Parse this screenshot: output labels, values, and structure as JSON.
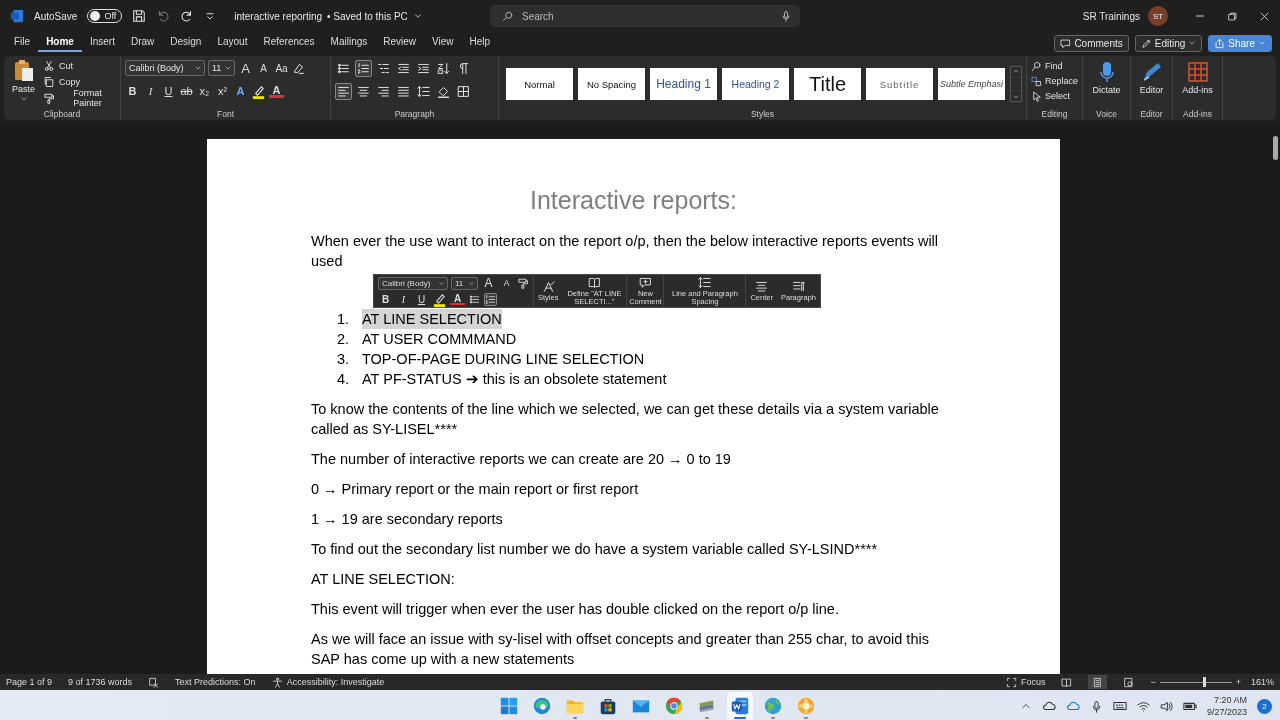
{
  "title_bar": {
    "autosave": {
      "label": "AutoSave",
      "on": false,
      "state": "Off"
    },
    "document_name": "interactive reporting",
    "save_status": "• Saved to this PC",
    "search": {
      "placeholder": "Search"
    },
    "user": {
      "name": "SR Trainings",
      "initials": "ST"
    }
  },
  "menu_tabs": [
    {
      "label": "File",
      "selected": false
    },
    {
      "label": "Home",
      "selected": true
    },
    {
      "label": "Insert",
      "selected": false
    },
    {
      "label": "Draw",
      "selected": false
    },
    {
      "label": "Design",
      "selected": false
    },
    {
      "label": "Layout",
      "selected": false
    },
    {
      "label": "References",
      "selected": false
    },
    {
      "label": "Mailings",
      "selected": false
    },
    {
      "label": "Review",
      "selected": false
    },
    {
      "label": "View",
      "selected": false
    },
    {
      "label": "Help",
      "selected": false
    }
  ],
  "header_buttons": [
    {
      "kind": "comments",
      "label": "Comments"
    },
    {
      "kind": "editing",
      "label": "Editing"
    },
    {
      "kind": "share",
      "label": "Share"
    }
  ],
  "ribbon": {
    "clipboard": {
      "label": "Clipboard",
      "paste": "Paste",
      "tools": [
        {
          "kind": "cut",
          "label": "Cut"
        },
        {
          "kind": "copy",
          "label": "Copy"
        },
        {
          "kind": "format_painter",
          "label": "Format Painter"
        }
      ]
    },
    "font": {
      "label": "Font",
      "font_name": "Calibri (Body)",
      "font_size": "11",
      "size_tools": [
        {
          "kind": "grow",
          "glyph": "A"
        },
        {
          "kind": "shrink",
          "glyph": "A"
        },
        {
          "kind": "case",
          "glyph": "Aa"
        }
      ],
      "format_tools": [
        {
          "kind": "bold",
          "glyph": "B"
        },
        {
          "kind": "italic",
          "glyph": "I"
        },
        {
          "kind": "underline",
          "glyph": "U"
        },
        {
          "kind": "strike",
          "glyph": "ab"
        },
        {
          "kind": "subscript",
          "glyph": "x₂"
        },
        {
          "kind": "superscript",
          "glyph": "x²"
        },
        {
          "kind": "effects",
          "glyph": "A"
        },
        {
          "kind": "highlight"
        },
        {
          "kind": "font_color",
          "glyph": "A"
        }
      ]
    },
    "paragraph": {
      "label": "Paragraph",
      "row1": [
        {
          "kind": "bullets",
          "on": false
        },
        {
          "kind": "numbering",
          "on": true
        },
        {
          "kind": "multilevel",
          "on": false
        },
        {
          "kind": "decrease_indent",
          "on": false
        },
        {
          "kind": "increase_indent",
          "on": false
        },
        {
          "kind": "sort",
          "on": false
        },
        {
          "kind": "show_marks",
          "on": false
        }
      ],
      "row2": [
        {
          "kind": "align_left",
          "on": true
        },
        {
          "kind": "align_center",
          "on": false
        },
        {
          "kind": "align_right",
          "on": false
        },
        {
          "kind": "justify",
          "on": false
        },
        {
          "kind": "line_spacing",
          "on": false
        },
        {
          "kind": "shading",
          "on": false
        },
        {
          "kind": "borders",
          "on": false
        }
      ]
    },
    "styles": {
      "label": "Styles",
      "items": [
        {
          "kind": "normal",
          "label": "Normal"
        },
        {
          "kind": "no_spacing",
          "label": "No Spacing"
        },
        {
          "kind": "heading1",
          "label": "Heading 1"
        },
        {
          "kind": "heading2",
          "label": "Heading 2"
        },
        {
          "kind": "title",
          "label": "Title"
        },
        {
          "kind": "subtitle",
          "label": "Subtitle"
        },
        {
          "kind": "subtle_emphasis",
          "label": "Subtle Emphasi"
        }
      ]
    },
    "editing": {
      "label": "Editing",
      "items": [
        {
          "kind": "find",
          "label": "Find"
        },
        {
          "kind": "replace",
          "label": "Replace"
        },
        {
          "kind": "select",
          "label": "Select"
        }
      ]
    },
    "voice": {
      "label": "Voice",
      "button": "Dictate"
    },
    "editor": {
      "label": "Editor",
      "button": "Editor"
    },
    "addins": {
      "label": "Add-ins",
      "button": "Add-ins"
    }
  },
  "mini_toolbar": {
    "font_name": "Calibri (Body)",
    "font_size": "11",
    "size_tools": [
      {
        "kind": "grow",
        "glyph": "A"
      },
      {
        "kind": "shrink",
        "glyph": "A"
      }
    ],
    "format_tools": [
      {
        "kind": "bold",
        "glyph": "B"
      },
      {
        "kind": "italic",
        "glyph": "I"
      },
      {
        "kind": "underline",
        "glyph": "U"
      },
      {
        "kind": "highlight"
      },
      {
        "kind": "font_color",
        "glyph": "A"
      }
    ],
    "list_tools": [
      {
        "kind": "bullets",
        "on": false
      },
      {
        "kind": "numbering",
        "on": true
      }
    ],
    "buttons": [
      {
        "kind": "styles",
        "label": "Styles"
      },
      {
        "kind": "define",
        "label": "Define \"AT LINE SELECTI...\""
      },
      {
        "kind": "new_comment",
        "label": "New Comment"
      },
      {
        "kind": "line_spacing",
        "label": "Line and Paragraph Spacing"
      },
      {
        "kind": "center",
        "label": "Center"
      },
      {
        "kind": "paragraph",
        "label": "Paragraph"
      }
    ]
  },
  "document": {
    "heading": "Interactive reports:",
    "blocks": [
      {
        "kind": "paragraph",
        "text": "When ever the use want to interact on the report o/p, then the below interactive reports events will used"
      },
      {
        "kind": "list",
        "items": [
          {
            "number": "1.",
            "text": "AT LINE SELECTION",
            "selected": true
          },
          {
            "number": "2.",
            "text": "AT USER COMMMAND",
            "selected": false
          },
          {
            "number": "3.",
            "text": "TOP-OF-PAGE DURING LINE SELECTION",
            "selected": false
          },
          {
            "number": "4.",
            "text": "AT PF-STATUS ➔ this is an obsolete statement",
            "selected": false
          }
        ]
      },
      {
        "kind": "paragraph",
        "text": "To know the contents of the line which we selected, we can get these details via a system variable called as SY-LISEL****"
      },
      {
        "kind": "paragraph",
        "text": "The number of interactive reports we can create are 20 → 0 to 19"
      },
      {
        "kind": "paragraph",
        "text": "0 → Primary report or the main report or first report"
      },
      {
        "kind": "paragraph",
        "text": "1 → 19 are secondary reports"
      },
      {
        "kind": "paragraph",
        "text": "To find out the secondary list number we do have a system variable called SY-LSIND****"
      },
      {
        "kind": "paragraph",
        "text": "AT LINE SELECTION:"
      },
      {
        "kind": "paragraph",
        "text": "This event will trigger when ever the user has double clicked on the report o/p line."
      },
      {
        "kind": "paragraph",
        "text": "As we will face an issue with sy-lisel with offset concepts and greater than 255 char, to avoid this SAP has come up with a new statements"
      }
    ]
  },
  "status_bar": {
    "page": "Page 1 of 9",
    "words": "9 of 1736 words",
    "text_predictions": "Text Predictions: On",
    "accessibility": "Accessibility: Investigate",
    "focus": "Focus",
    "views": [
      {
        "kind": "read",
        "selected": false
      },
      {
        "kind": "print",
        "selected": true
      },
      {
        "kind": "web",
        "selected": false
      }
    ],
    "zoom": {
      "minus": "−",
      "plus": "+",
      "level": 0.62,
      "reading": "161%"
    }
  },
  "taskbar": {
    "apps": [
      {
        "kind": "start",
        "running": false,
        "active": false
      },
      {
        "kind": "edge",
        "running": false,
        "active": false
      },
      {
        "kind": "explorer",
        "running": true,
        "active": false
      },
      {
        "kind": "store",
        "running": false,
        "active": false
      },
      {
        "kind": "mail",
        "running": false,
        "active": false
      },
      {
        "kind": "chrome",
        "running": false,
        "active": false
      },
      {
        "kind": "sheets",
        "running": true,
        "active": false
      },
      {
        "kind": "word",
        "running": true,
        "active": true
      },
      {
        "kind": "globe",
        "running": true,
        "active": false
      },
      {
        "kind": "flower",
        "running": true,
        "active": false
      }
    ],
    "time": "7:20 AM",
    "date": "9/27/2023",
    "notifications": "2"
  }
}
